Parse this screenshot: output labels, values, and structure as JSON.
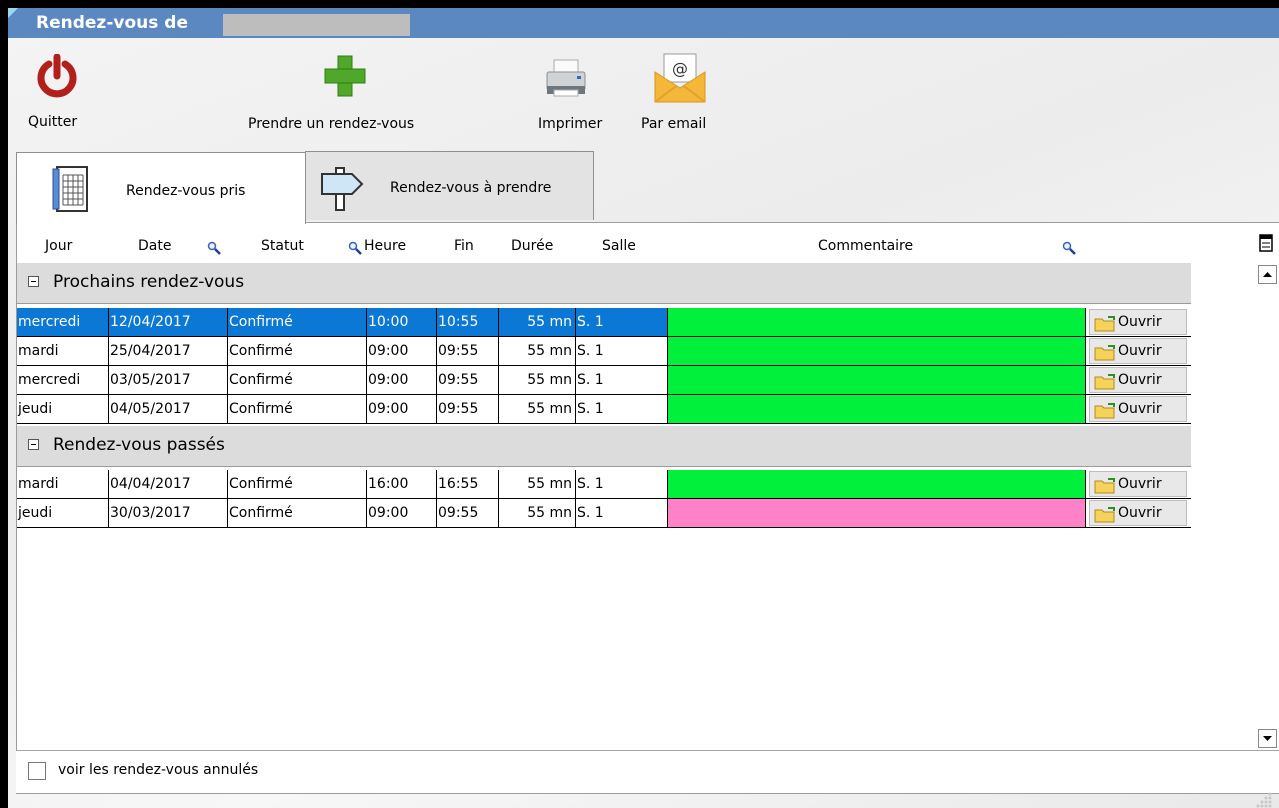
{
  "window": {
    "title": "Rendez-vous de"
  },
  "toolbar": {
    "quit": "Quitter",
    "new_appointment": "Prendre un rendez-vous",
    "print": "Imprimer",
    "email": "Par email"
  },
  "tabs": [
    {
      "label": "Rendez-vous pris"
    },
    {
      "label": "Rendez-vous à prendre"
    }
  ],
  "columns": [
    "Jour",
    "Date",
    "Statut",
    "Heure",
    "Fin",
    "Durée",
    "Salle",
    "Commentaire"
  ],
  "groups": [
    {
      "label": "Prochains rendez-vous",
      "rows": [
        {
          "jour": "mercredi",
          "date": "12/04/2017",
          "statut": "Confirmé",
          "heure": "10:00",
          "fin": "10:55",
          "duree": "55 mn",
          "salle": "S. 1",
          "color": "#00f03c",
          "action": "Ouvrir",
          "selected": true
        },
        {
          "jour": "mardi",
          "date": "25/04/2017",
          "statut": "Confirmé",
          "heure": "09:00",
          "fin": "09:55",
          "duree": "55 mn",
          "salle": "S. 1",
          "color": "#00f03c",
          "action": "Ouvrir"
        },
        {
          "jour": "mercredi",
          "date": "03/05/2017",
          "statut": "Confirmé",
          "heure": "09:00",
          "fin": "09:55",
          "duree": "55 mn",
          "salle": "S. 1",
          "color": "#00f03c",
          "action": "Ouvrir"
        },
        {
          "jour": "jeudi",
          "date": "04/05/2017",
          "statut": "Confirmé",
          "heure": "09:00",
          "fin": "09:55",
          "duree": "55 mn",
          "salle": "S. 1",
          "color": "#00f03c",
          "action": "Ouvrir"
        }
      ]
    },
    {
      "label": "Rendez-vous passés",
      "rows": [
        {
          "jour": "mardi",
          "date": "04/04/2017",
          "statut": "Confirmé",
          "heure": "16:00",
          "fin": "16:55",
          "duree": "55 mn",
          "salle": "S. 1",
          "color": "#00f03c",
          "action": "Ouvrir"
        },
        {
          "jour": "jeudi",
          "date": "30/03/2017",
          "statut": "Confirmé",
          "heure": "09:00",
          "fin": "09:55",
          "duree": "55 mn",
          "salle": "S. 1",
          "color": "#ff82c8",
          "action": "Ouvrir"
        }
      ]
    }
  ],
  "footer": {
    "show_cancelled": "voir les rendez-vous annulés",
    "checked": false
  },
  "colors": {
    "titlebar": "#5b88c1",
    "selection": "#0a78d4",
    "confirmed": "#00f03c",
    "past_other": "#ff82c8"
  }
}
